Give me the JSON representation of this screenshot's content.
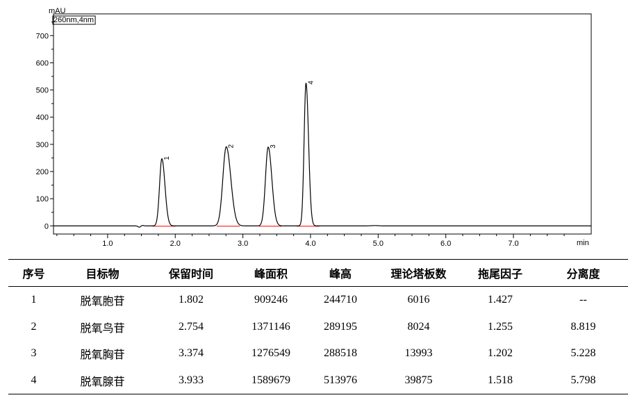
{
  "chart_data": {
    "type": "line",
    "y_unit": "mAU",
    "channel": "260nm,4nm",
    "x_unit": "min",
    "xlim": [
      0.2,
      8.15
    ],
    "ylim": [
      -30,
      780
    ],
    "x_ticks": [
      "1.0",
      "2.0",
      "3.0",
      "4.0",
      "5.0",
      "6.0",
      "7.0"
    ],
    "y_ticks": [
      "0",
      "100",
      "200",
      "300",
      "400",
      "500",
      "600",
      "700"
    ],
    "grid": false,
    "baseline_color": "#ff0000",
    "trace_color": "#000000",
    "peaks": [
      {
        "label": "1",
        "retention_time": 1.802,
        "height_mau": 247
      },
      {
        "label": "2",
        "retention_time": 2.754,
        "height_mau": 291
      },
      {
        "label": "3",
        "retention_time": 3.374,
        "height_mau": 290
      },
      {
        "label": "4",
        "retention_time": 3.933,
        "height_mau": 525
      }
    ]
  },
  "table": {
    "headers": [
      "序号",
      "目标物",
      "保留时间",
      "峰面积",
      "峰高",
      "理论塔板数",
      "拖尾因子",
      "分离度"
    ],
    "rows": [
      [
        "1",
        "脱氧胞苷",
        "1.802",
        "909246",
        "244710",
        "6016",
        "1.427",
        "--"
      ],
      [
        "2",
        "脱氧鸟苷",
        "2.754",
        "1371146",
        "289195",
        "8024",
        "1.255",
        "8.819"
      ],
      [
        "3",
        "脱氧胸苷",
        "3.374",
        "1276549",
        "288518",
        "13993",
        "1.202",
        "5.228"
      ],
      [
        "4",
        "脱氧腺苷",
        "3.933",
        "1589679",
        "513976",
        "39875",
        "1.518",
        "5.798"
      ]
    ]
  }
}
